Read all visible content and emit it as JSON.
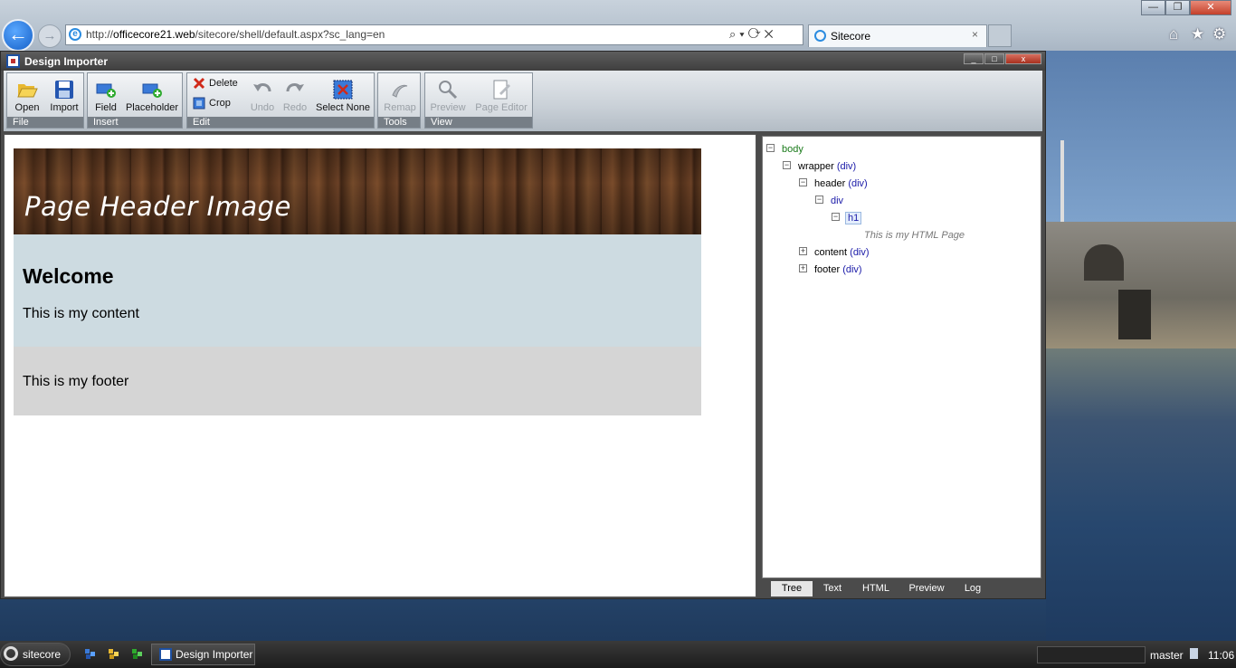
{
  "browser": {
    "url_prefix": "http://",
    "url_host": "officecore21.web",
    "url_path": "/sitecore/shell/default.aspx?sc_lang=en",
    "tab_title": "Sitecore",
    "tab_close": "×",
    "address_tools": "⌕▾⟳✕"
  },
  "window_controls": {
    "minimize": "—",
    "maximize": "❐",
    "close": "✕"
  },
  "app": {
    "title": "Design Importer",
    "controls": {
      "minimize": "_",
      "maximize": "□",
      "close": "x"
    }
  },
  "ribbon": {
    "groups": [
      {
        "label": "File",
        "buttons": [
          {
            "label": "Open",
            "icon": "folder-open-icon"
          },
          {
            "label": "Import",
            "icon": "floppy-disk-icon"
          }
        ]
      },
      {
        "label": "Insert",
        "buttons": [
          {
            "label": "Field",
            "icon": "add-field-icon"
          },
          {
            "label": "Placeholder",
            "icon": "add-placeholder-icon"
          }
        ]
      },
      {
        "label": "Edit",
        "buttons": [
          {
            "label": "Delete",
            "icon": "delete-x-icon"
          },
          {
            "label": "Crop",
            "icon": "crop-icon"
          },
          {
            "label": "Undo",
            "icon": "undo-icon"
          },
          {
            "label": "Redo",
            "icon": "redo-icon"
          },
          {
            "label": "Select None",
            "icon": "select-none-icon"
          }
        ]
      },
      {
        "label": "Tools",
        "buttons": [
          {
            "label": "Remap",
            "icon": "remap-icon"
          }
        ]
      },
      {
        "label": "View",
        "buttons": [
          {
            "label": "Preview",
            "icon": "magnifier-icon"
          },
          {
            "label": "Page Editor",
            "icon": "page-editor-icon"
          }
        ]
      }
    ]
  },
  "preview": {
    "header_image_text": "Page Header Image",
    "heading": "Welcome",
    "content": "This is my content",
    "footer": "This is my footer"
  },
  "tree": {
    "body": "body",
    "wrapper": "wrapper",
    "header": "header",
    "div": "div",
    "h1": "h1",
    "h1_text": "This is my HTML Page",
    "content": "content",
    "footer": "footer",
    "tag_div": "(div)",
    "expanded": "−",
    "collapsed": "+"
  },
  "pane_tabs": [
    "Tree",
    "Text",
    "HTML",
    "Preview",
    "Log"
  ],
  "taskbar": {
    "start_label": "sitecore",
    "task_label": "Design Importer",
    "database": "master",
    "clock": "11:06"
  },
  "colors": {
    "tree_green": "#1a7a1a",
    "tree_blue": "#1a1aa8",
    "accent": "#1d4fa0"
  }
}
